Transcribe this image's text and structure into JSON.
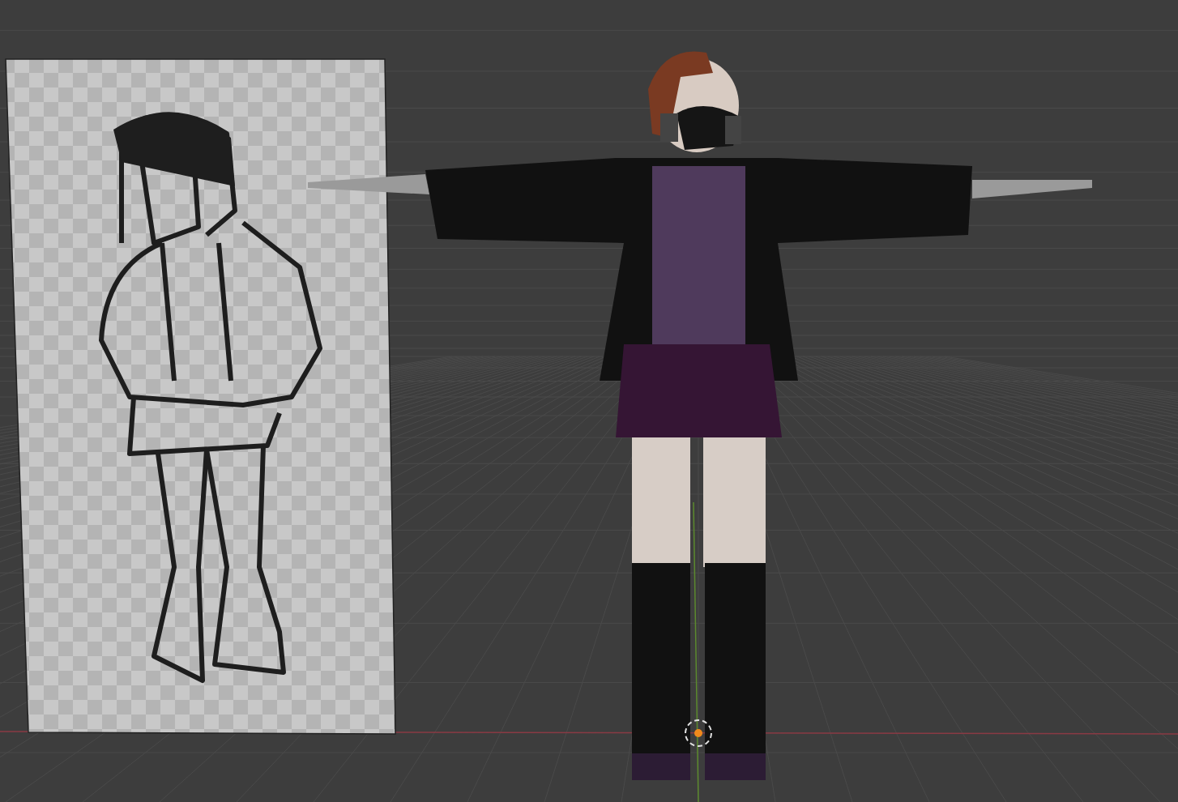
{
  "viewport": {
    "grid": true,
    "axes": true,
    "cursor_3d": true
  }
}
